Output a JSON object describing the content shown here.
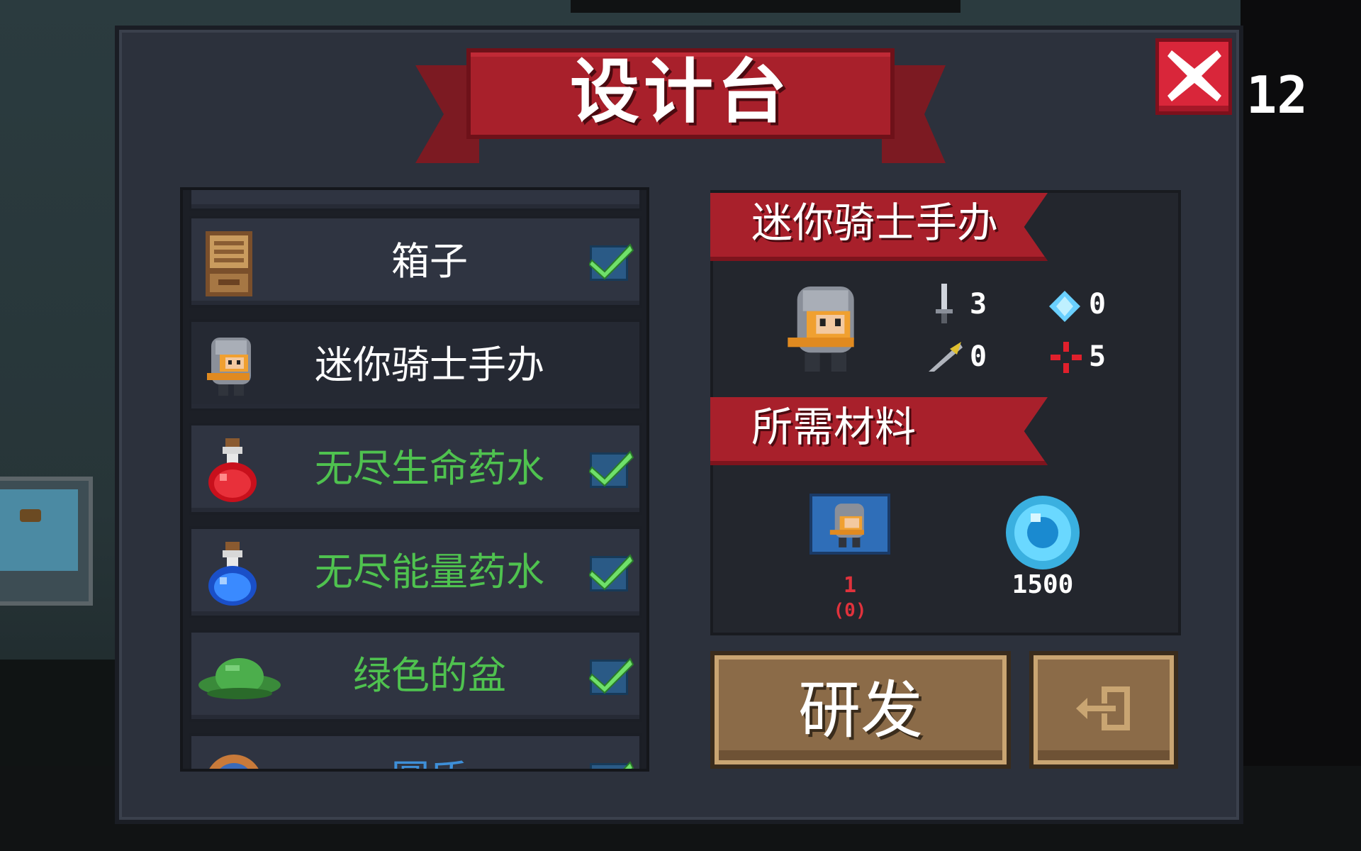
{
  "panel": {
    "title": "设计台",
    "counter": "12"
  },
  "list": {
    "items": [
      {
        "label": "箱子",
        "color": "white",
        "checked": true,
        "icon": "crate-icon"
      },
      {
        "label": "迷你骑士手办",
        "color": "white",
        "checked": false,
        "icon": "knight-figure-icon",
        "selected": true
      },
      {
        "label": "无尽生命药水",
        "color": "green",
        "checked": true,
        "icon": "red-potion-icon"
      },
      {
        "label": "无尽能量药水",
        "color": "green",
        "checked": true,
        "icon": "blue-potion-icon"
      },
      {
        "label": "绿色的盆",
        "color": "green",
        "checked": true,
        "icon": "green-pot-icon"
      },
      {
        "label": "圆盾",
        "color": "blue",
        "checked": true,
        "icon": "round-shield-icon"
      }
    ]
  },
  "detail": {
    "name": "迷你骑士手办",
    "stats": {
      "attack": "3",
      "crit_gem": "0",
      "speed": "0",
      "precision": "5"
    },
    "materials_title": "所需材料",
    "materials": {
      "blueprint_required": "1",
      "blueprint_owned": "(0)",
      "gems": "1500"
    }
  },
  "buttons": {
    "research": "研发"
  },
  "colors": {
    "panel": "#2c313c",
    "ribbon": "#a8202b",
    "green_text": "#4fc24f",
    "blue_text": "#3e8fd8",
    "button": "#8b6b48"
  }
}
